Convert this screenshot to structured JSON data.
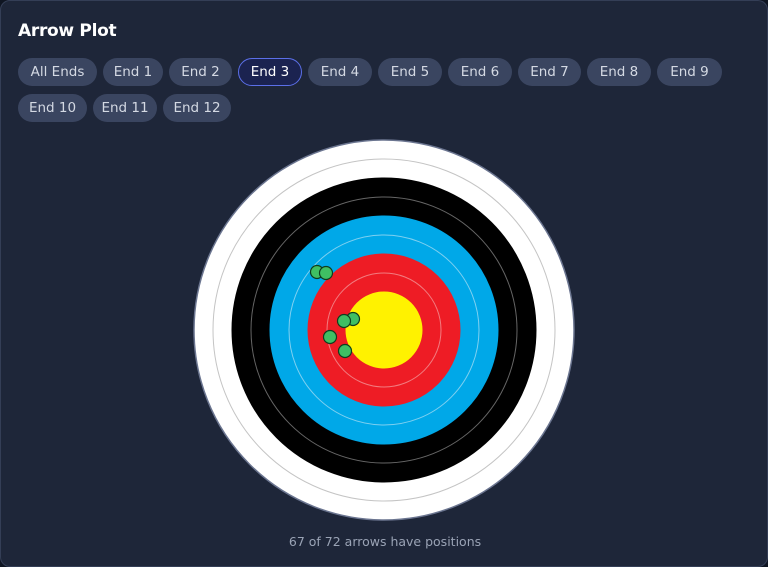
{
  "title": "Arrow Plot",
  "filters": [
    "All Ends",
    "End 1",
    "End 2",
    "End 3",
    "End 4",
    "End 5",
    "End 6",
    "End 7",
    "End 8",
    "End 9",
    "End 10",
    "End 11",
    "End 12"
  ],
  "active_filter": "End 3",
  "footer": "67 of 72 arrows have positions",
  "colors": {
    "white_ring": "#ffffff",
    "black_ring": "#000000",
    "blue_ring": "#00a8e8",
    "red_ring": "#ee1c25",
    "gold_ring": "#fff200",
    "arrow_fill": "#3fbf63",
    "arrow_stroke": "#0f3d1e",
    "active_border": "#5b6fe8"
  }
}
